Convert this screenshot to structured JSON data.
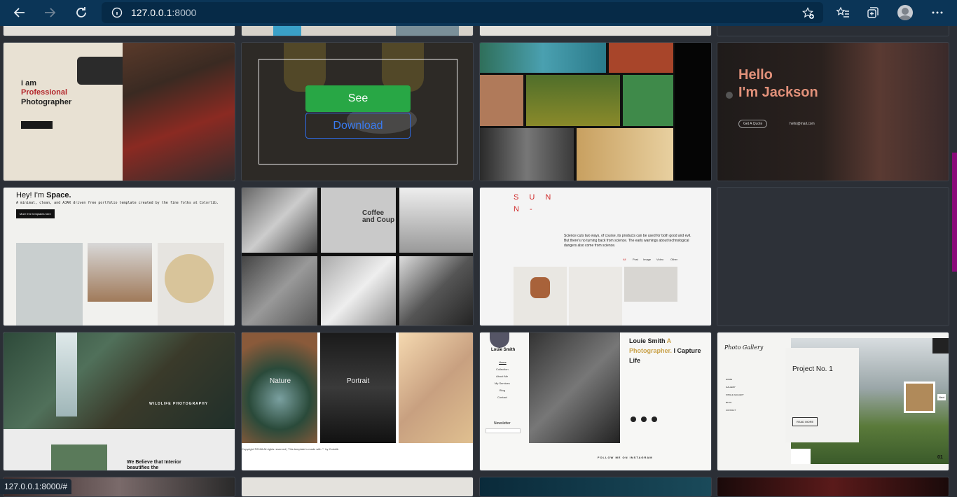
{
  "browser": {
    "url_host": "127.0.0.1",
    "url_port": ":8000",
    "status_url": "127.0.0.1:8000/#"
  },
  "overlay": {
    "see_label": "See",
    "download_label": "Download"
  },
  "cards": {
    "photographer": {
      "line1": "i am",
      "line2": "Professional",
      "line3": "Photographer"
    },
    "jackson": {
      "hello": "Hello",
      "name": "I'm Jackson",
      "button": "Get A Quote",
      "email": "hello@mail.com"
    },
    "space": {
      "title_prefix": "Hey! I'm ",
      "title_name": "Space.",
      "tagline": "A minimal, clean, and AJAX driven free portfolio template created by the fine folks at Colorlib.",
      "button": "More free templates here"
    },
    "coffee": {
      "sign": "Coffee and Coup"
    },
    "sun": {
      "logo1": "S U N",
      "logo2": "N -",
      "text": "Science cuts two ways, of course, its products can be used for both good and evil. But there's no turning back from science. The early warnings about technological dangers also come from science.",
      "filters": [
        "All",
        "Post",
        "Image",
        "Video",
        "Other"
      ]
    },
    "wildlife": {
      "title": "WILDLIFE PHOTOGRAPHY",
      "believe": "We Believe that Interior beautifies the"
    },
    "nature": {
      "left": "Nature",
      "mid": "Portrait",
      "footer": "Copyright ©2018 All rights reserved | This template is made with ♡ by Colorlib"
    },
    "louie": {
      "name": "Louie Smith",
      "title_a": "Louie Smith ",
      "title_b": "A Photographer.",
      "title_c": " I Capture Life",
      "menu": [
        "Home",
        "Collection",
        "About Me",
        "My Services",
        "Blog",
        "Contact"
      ],
      "newsletter": "Newsletter",
      "follow": "FOLLOW ME ON INSTAGRAM"
    },
    "gallery": {
      "logo": "Photo Gallery",
      "project": "Project No. 1",
      "read_more": "READ MORE",
      "menu": [
        "HOME",
        "GALLERY",
        "SINGLE GALLERY",
        "BLOG",
        "CONTACT"
      ],
      "next": "Next",
      "counter": "01"
    }
  }
}
